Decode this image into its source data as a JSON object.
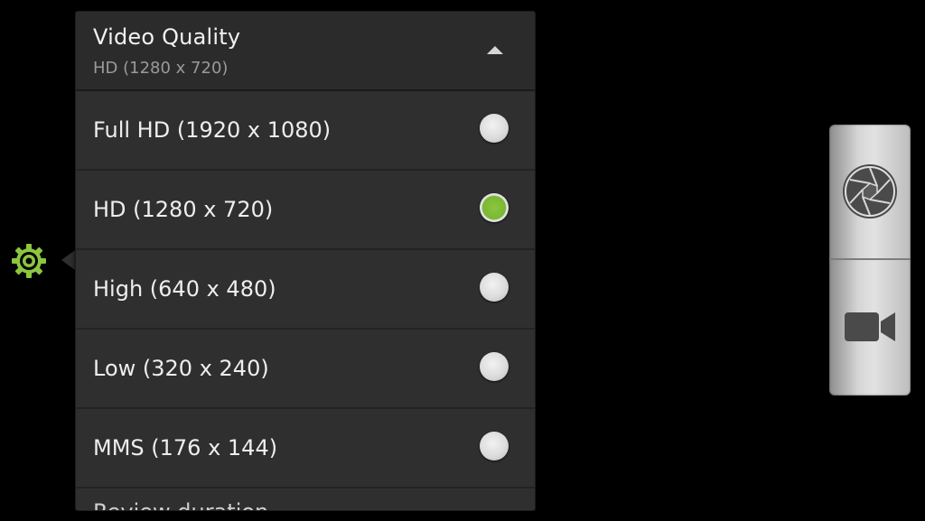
{
  "settings_icon": {
    "name": "gear-icon",
    "color": "#8cc63f"
  },
  "popup": {
    "title": "Video Quality",
    "current_value": "HD (1280 x 720)",
    "collapse_icon": "chevron-up-icon",
    "selected_color": "#7ab833",
    "options": [
      {
        "label": "Full HD (1920 x 1080)",
        "selected": false
      },
      {
        "label": "HD (1280 x 720)",
        "selected": true
      },
      {
        "label": "High (640 x 480)",
        "selected": false
      },
      {
        "label": "Low (320 x 240)",
        "selected": false
      },
      {
        "label": "MMS (176 x 144)",
        "selected": false
      }
    ],
    "next_setting_partial": "Review duration"
  },
  "mode_switch": {
    "photo_icon": "shutter-icon",
    "video_icon": "video-camera-icon"
  }
}
